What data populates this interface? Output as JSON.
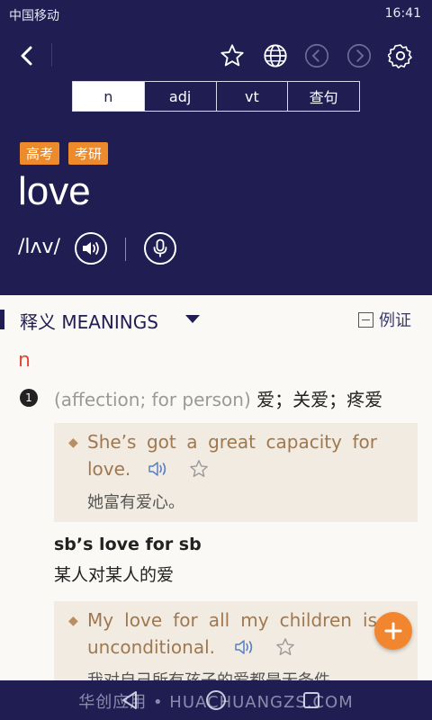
{
  "status_bar": {
    "carrier": "中国移动",
    "time": "16:41"
  },
  "toolbar": {
    "back_icon": "chevron-left-icon",
    "favorite_icon": "star-outline-icon",
    "web_icon": "globe-icon",
    "prev_icon": "circle-chevron-left-icon",
    "next_icon": "circle-chevron-right-icon",
    "settings_icon": "gear-icon"
  },
  "pos_tabs": [
    {
      "label": "n",
      "active": true
    },
    {
      "label": "adj",
      "active": false
    },
    {
      "label": "vt",
      "active": false
    },
    {
      "label": "查句",
      "active": false
    }
  ],
  "tags": [
    "高考",
    "考研"
  ],
  "word": {
    "headword": "love",
    "phonetic": "/lʌv/"
  },
  "section": {
    "title": "释义 MEANINGS",
    "examples_toggle": "例证"
  },
  "entry": {
    "pos": "n",
    "sense_number": "1",
    "sense_gloss": "(affection; for person)",
    "sense_zh": "爱；关爱；疼爱",
    "example1": {
      "en_line1": "She’s got a great capacity for",
      "en_line2": "love.",
      "zh": "她富有爱心。"
    },
    "phrase": "sb’s love for sb",
    "phrase_zh": "某人对某人的爱",
    "example2": {
      "en_line1": "My love for all my children is",
      "en_line2": "unconditional.",
      "zh": "我对自己所有孩子的爱都是无条件"
    }
  },
  "watermark": "华创应用 • HUACHUANGZS.COM",
  "colors": {
    "header_bg": "#1f1d52",
    "accent_orange": "#ec8a2c",
    "pos_red": "#e0483a",
    "example_bg": "#f2ebe1",
    "example_text": "#a07850"
  }
}
